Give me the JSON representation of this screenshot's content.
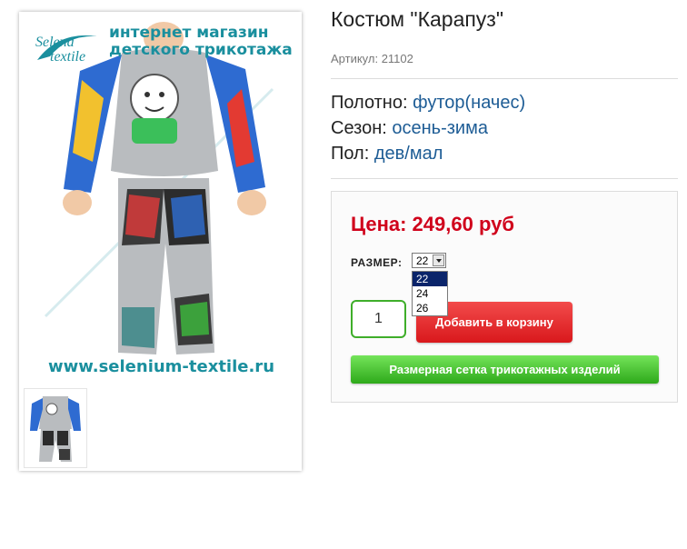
{
  "product": {
    "title": "Костюм \"Карапуз\"",
    "sku": "Артикул: 21102",
    "attributes": [
      {
        "label": "Полотно:",
        "value": "футор(начес)"
      },
      {
        "label": "Сезон:",
        "value": "осень-зима"
      },
      {
        "label": "Пол:",
        "value": "дев/мал"
      }
    ]
  },
  "gallery": {
    "logo_line1": "Selena",
    "logo_line2": "textile",
    "banner_line1": "интернет магазин",
    "banner_line2": "детского трикотажа",
    "site_url": "www.selenium-textile.ru"
  },
  "buy": {
    "price": "Цена: 249,60 руб",
    "size_label": "РАЗМЕР:",
    "size_selected": "22",
    "size_options": [
      "22",
      "24",
      "26"
    ],
    "quantity": "1",
    "add_to_cart_label": "Добавить в корзину",
    "size_chart_label": "Размерная сетка трикотажных изделий"
  },
  "colors": {
    "price": "#d0021b",
    "link": "#1d5c95",
    "add_button": "#e52a2a",
    "chart_button": "#3fb72a",
    "qty_border": "#3fae2a"
  }
}
